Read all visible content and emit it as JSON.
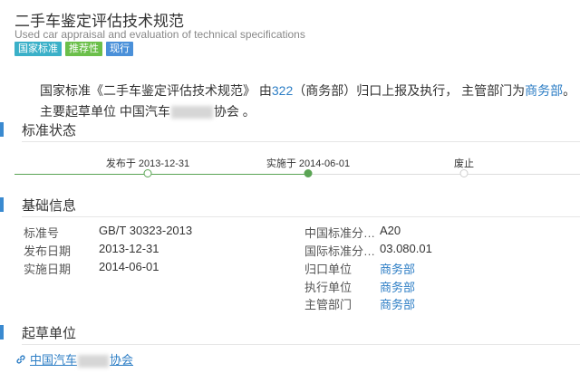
{
  "header": {
    "title": "二手车鉴定评估技术规范",
    "subtitle": "Used car appraisal and evaluation of technical specifications",
    "badges": [
      "国家标准",
      "推荐性",
      "现行"
    ]
  },
  "intro": {
    "line1_prefix": "国家标准《二手车鉴定评估技术规范》 由",
    "line1_link1": "322",
    "line1_mid": "（商务部）归口上报及执行， 主管部门为",
    "line1_link2": "商务部",
    "line1_suffix": "。",
    "line2_prefix": "主要起草单位 中国汽车",
    "line2_suffix": "协会 。"
  },
  "status_section": {
    "title": "标准状态",
    "timeline": [
      {
        "label": "发布于 2013-12-31",
        "state": "done"
      },
      {
        "label": "实施于 2014-06-01",
        "state": "current"
      },
      {
        "label": "废止",
        "state": "future"
      }
    ],
    "colors": {
      "done": "#5aa454",
      "future": "#cfcfcf"
    }
  },
  "basic_section": {
    "title": "基础信息",
    "left": [
      {
        "label": "标准号",
        "value": "GB/T 30323-2013"
      },
      {
        "label": "发布日期",
        "value": "2013-12-31"
      },
      {
        "label": "实施日期",
        "value": "2014-06-01"
      }
    ],
    "right": [
      {
        "label": "中国标准分…",
        "value": "A20",
        "link": false
      },
      {
        "label": "国际标准分…",
        "value": "03.080.01",
        "link": false
      },
      {
        "label": "归口单位",
        "value": "商务部",
        "link": true
      },
      {
        "label": "执行单位",
        "value": "商务部",
        "link": true
      },
      {
        "label": "主管部门",
        "value": "商务部",
        "link": true
      }
    ]
  },
  "draft_section": {
    "title": "起草单位",
    "org_prefix": "中国汽车",
    "org_suffix": "协会"
  }
}
